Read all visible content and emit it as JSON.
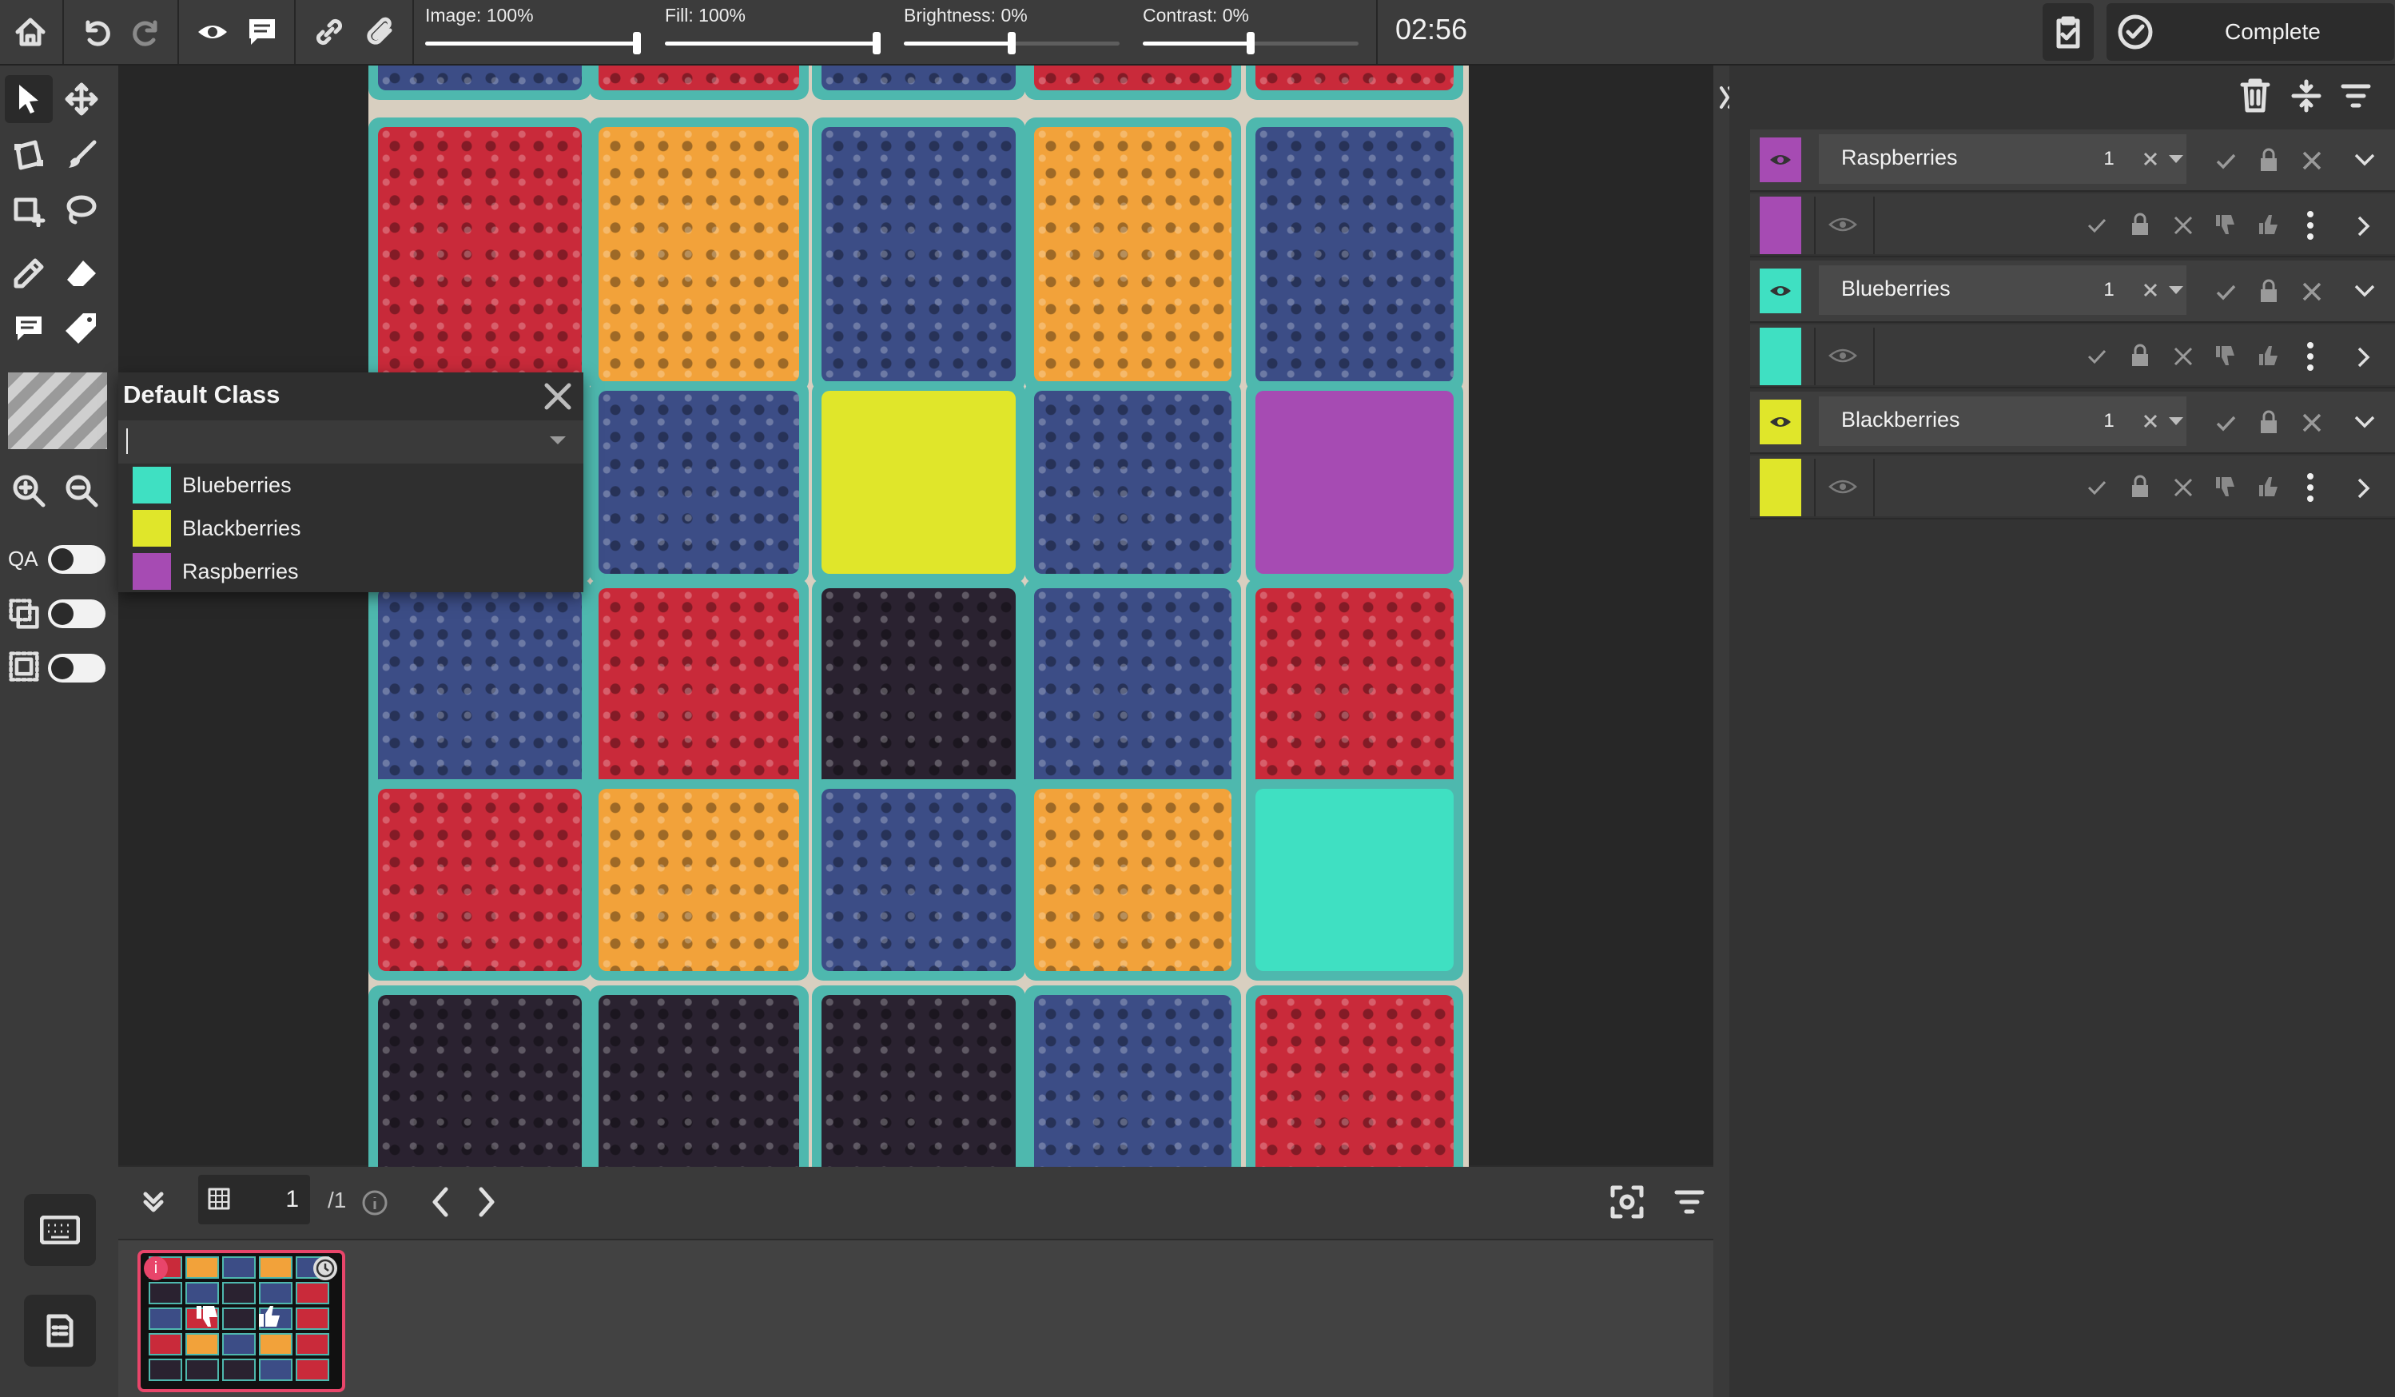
{
  "toolbar": {
    "sliders": [
      {
        "label": "Image: 100%",
        "value": 1.0
      },
      {
        "label": "Fill: 100%",
        "value": 1.0
      },
      {
        "label": "Brightness: 0%",
        "value": 0.5
      },
      {
        "label": "Contrast: 0%",
        "value": 0.5
      }
    ],
    "timer": "02:56",
    "complete_label": "Complete"
  },
  "left_tools": {
    "qa_label": "QA",
    "toggles": {
      "qa": false,
      "tool2": false,
      "tool3": false
    }
  },
  "class_popup": {
    "title": "Default Class",
    "input_value": "",
    "options": [
      {
        "label": "Blueberries",
        "color": "#3fe0c2"
      },
      {
        "label": "Blackberries",
        "color": "#e0e62a"
      },
      {
        "label": "Raspberries",
        "color": "#a64bb3"
      }
    ]
  },
  "right_panel": {
    "classes": [
      {
        "name": "Raspberries",
        "count": "1",
        "color": "#a64bb3"
      },
      {
        "name": "Blueberries",
        "count": "1",
        "color": "#3fe0c2"
      },
      {
        "name": "Blackberries",
        "count": "1",
        "color": "#e0e62a"
      }
    ]
  },
  "bottom": {
    "page_value": "1",
    "page_total": "/1"
  },
  "colors": {
    "accent_pink": "#e8456a",
    "raspberry": "#c92a3a",
    "blueberry": "#3c4d86",
    "blackberry": "#2a2230",
    "golden": "#f2a23a"
  }
}
